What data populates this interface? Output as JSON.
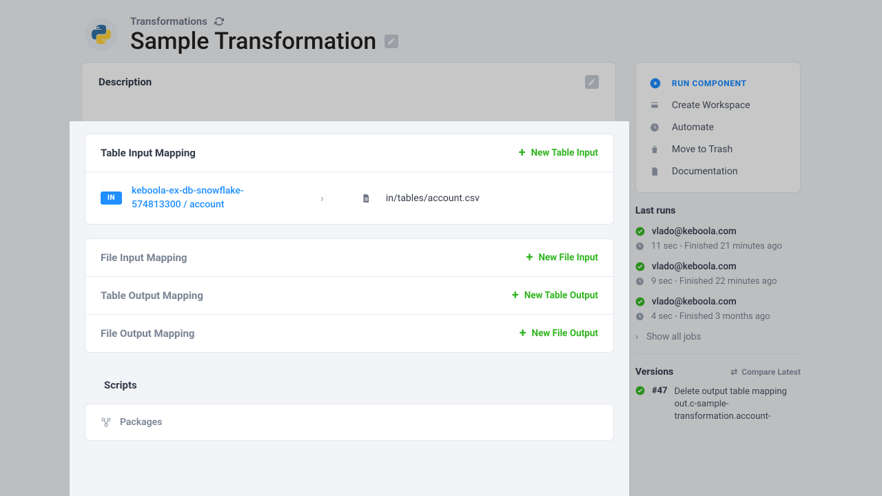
{
  "breadcrumb": "Transformations",
  "page_title": "Sample Transformation",
  "description_card_title": "Description",
  "sidebar": {
    "items": [
      {
        "label": "Run Component",
        "primary": true
      },
      {
        "label": "Create Workspace"
      },
      {
        "label": "Automate"
      },
      {
        "label": "Move to Trash"
      },
      {
        "label": "Documentation"
      }
    ]
  },
  "last_runs_title": "Last runs",
  "runs": [
    {
      "user": "vlado@keboola.com",
      "meta": "11 sec - Finished 21 minutes ago"
    },
    {
      "user": "vlado@keboola.com",
      "meta": "9 sec - Finished 22 minutes ago"
    },
    {
      "user": "vlado@keboola.com",
      "meta": "4 sec - Finished 3 months ago"
    }
  ],
  "show_all_jobs": "Show all jobs",
  "versions_title": "Versions",
  "compare_latest": "Compare Latest",
  "version": {
    "num": "#47",
    "msg": "Delete output table mapping out.c-sample-transformation.account-"
  },
  "panel": {
    "sections": {
      "table_input": {
        "title": "Table Input Mapping",
        "action": "New Table Input",
        "row": {
          "badge": "IN",
          "source": "keboola-ex-db-snowflake-574813300 / account",
          "dest": "in/tables/account.csv"
        }
      },
      "file_input": {
        "title": "File Input Mapping",
        "action": "New File Input"
      },
      "table_output": {
        "title": "Table Output Mapping",
        "action": "New Table Output"
      },
      "file_output": {
        "title": "File Output Mapping",
        "action": "New File Output"
      }
    },
    "scripts_title": "Scripts",
    "packages_label": "Packages"
  }
}
